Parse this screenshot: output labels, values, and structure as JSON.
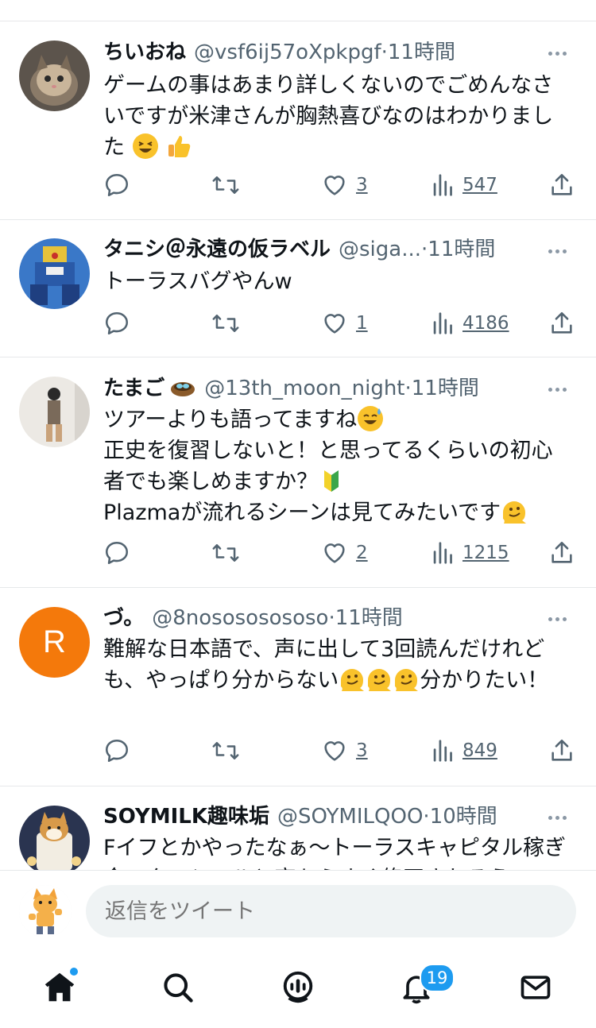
{
  "tweets": [
    {
      "name": "ちいおね",
      "handle": "@vsf6ij57oXpkpgf",
      "dot": "·",
      "time": "11時間",
      "text": "ゲームの事はあまり詳しくないのでごめんなさいですが米津さんが胸熱喜びなのはわかりました",
      "likes": "3",
      "views": "547"
    },
    {
      "name": "タニシ＠永遠の仮ラベル",
      "handle": "@siga...",
      "dot": "·",
      "time": "11時間",
      "text": "トーラスバグやんw",
      "likes": "1",
      "views": "4186"
    },
    {
      "name": "たまご",
      "handle": "@13th_moon_night",
      "dot": "·",
      "time": "11時間",
      "text_line1": "ツアーよりも語ってますね",
      "text_line2": "正史を復習しないと！と思ってるくらいの初心者でも楽しめますか？",
      "text_line3": "Plazmaが流れるシーンは見てみたいです",
      "likes": "2",
      "views": "1215"
    },
    {
      "name": "づ。",
      "handle": "@8nosososososo",
      "dot": "·",
      "time": "11時間",
      "text_part1": "難解な日本語で、声に出して3回読んだけれども、やっぱり分からない",
      "text_part2": "分かりたい！",
      "avatar_letter": "R",
      "likes": "3",
      "views": "849"
    },
    {
      "name": "SOYMILK趣味垢",
      "handle": "@SOYMILQOO",
      "dot": "·",
      "time": "10時間",
      "text": "Fイフとかやったなぁ〜トーラスキャピタル稼ぎ金スターシールと高ちらすぐ修正されるう"
    }
  ],
  "reply": {
    "placeholder": "返信をツイート"
  },
  "notifications": {
    "badge": "19"
  },
  "colors": {
    "accent": "#1d9bf0",
    "text": "#0f1419",
    "muted": "#536471",
    "avatar_orange": "#f4790b"
  },
  "icons": [
    "reply-icon",
    "retweet-icon",
    "like-icon",
    "views-icon",
    "share-icon",
    "home-icon",
    "search-icon",
    "spaces-icon",
    "bell-icon",
    "mail-icon"
  ]
}
